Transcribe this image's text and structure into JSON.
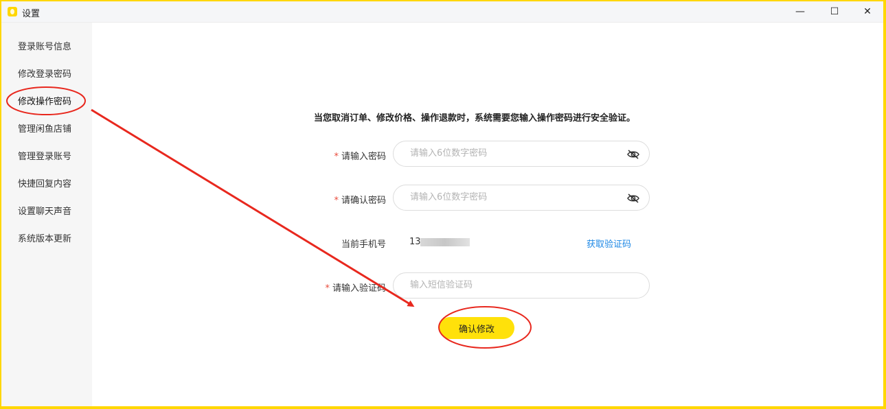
{
  "window": {
    "title": "设置",
    "controls": {
      "minimize": "—",
      "maximize": "☐",
      "close": "✕"
    }
  },
  "sidebar": {
    "items": [
      {
        "label": "登录账号信息",
        "active": false
      },
      {
        "label": "修改登录密码",
        "active": false
      },
      {
        "label": "修改操作密码",
        "active": true
      },
      {
        "label": "管理闲鱼店铺",
        "active": false
      },
      {
        "label": "管理登录账号",
        "active": false
      },
      {
        "label": "快捷回复内容",
        "active": false
      },
      {
        "label": "设置聊天声音",
        "active": false
      },
      {
        "label": "系统版本更新",
        "active": false
      }
    ]
  },
  "form": {
    "notice": "当您取消订单、修改价格、操作退款时，系统需要您输入操作密码进行安全验证。",
    "password": {
      "required_mark": "*",
      "label": "请输入密码",
      "placeholder": "请输入6位数字密码",
      "value": ""
    },
    "confirm_password": {
      "required_mark": "*",
      "label": "请确认密码",
      "placeholder": "请输入6位数字密码",
      "value": ""
    },
    "phone": {
      "label": "当前手机号",
      "value_prefix": "13",
      "get_code_label": "获取验证码"
    },
    "sms_code": {
      "required_mark": "*",
      "label": "请输入验证码",
      "placeholder": "输入短信验证码",
      "value": ""
    },
    "submit_label": "确认修改"
  },
  "colors": {
    "accent": "#ffe10a",
    "window_border": "#ffd700",
    "link": "#1e88e5",
    "required": "#e94b3c",
    "annotation": "#e8281e"
  },
  "icons": {
    "password_toggle": "eye-off-icon",
    "app": "xianyu-app-icon"
  }
}
